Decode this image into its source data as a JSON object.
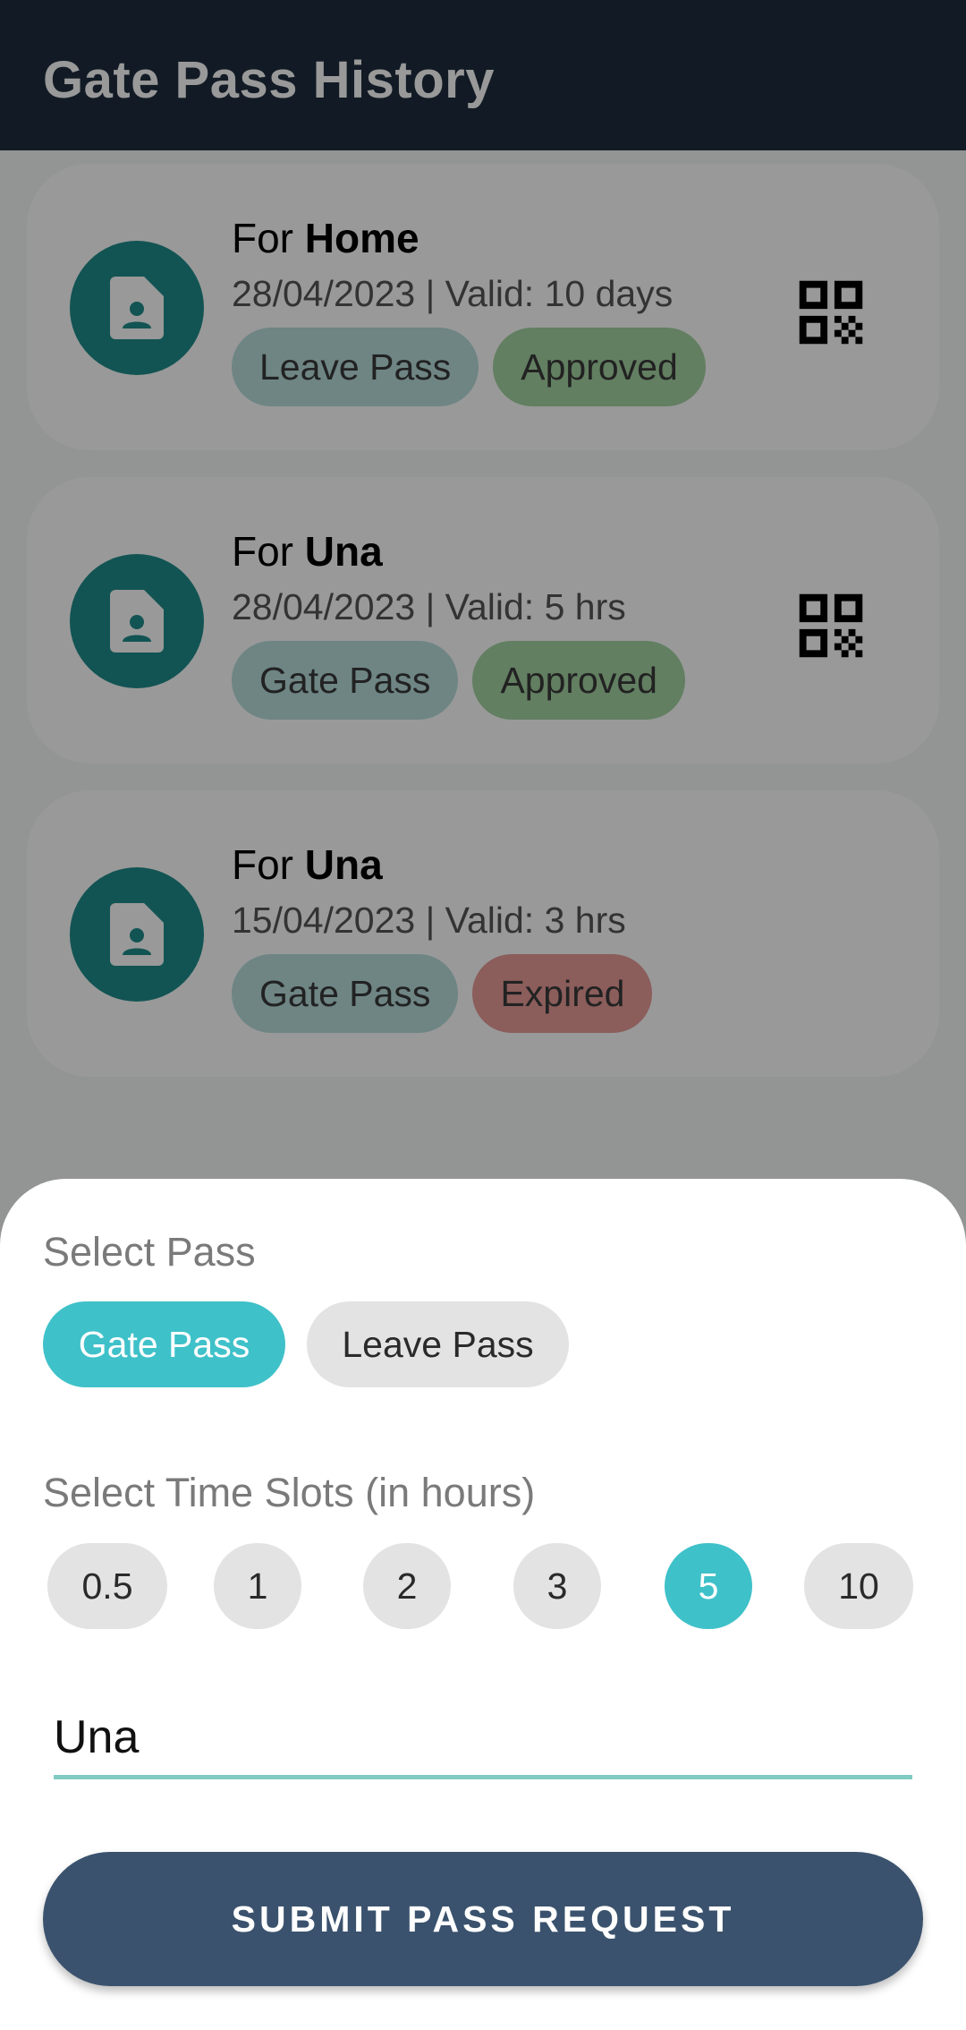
{
  "app_bar": {
    "title": "Gate Pass History"
  },
  "history": {
    "cards": [
      {
        "prefix": "For",
        "destination": "Home",
        "date": "28/04/2023",
        "separator": "|",
        "validity_label": "Valid:",
        "validity": "10 days",
        "type": "Leave Pass",
        "status": "Approved",
        "status_color": "#a4d4a2",
        "has_qr": true
      },
      {
        "prefix": "For",
        "destination": "Una",
        "date": "28/04/2023",
        "separator": "|",
        "validity_label": "Valid:",
        "validity": "5 hrs",
        "type": "Gate Pass",
        "status": "Approved",
        "status_color": "#a4d4a2",
        "has_qr": true
      },
      {
        "prefix": "For",
        "destination": "Una",
        "date": "15/04/2023",
        "separator": "|",
        "validity_label": "Valid:",
        "validity": "3 hrs",
        "type": "Gate Pass",
        "status": "Expired",
        "status_color": "#e89b98",
        "has_qr": false
      }
    ]
  },
  "sheet": {
    "pass_section_label": "Select Pass",
    "pass_types": [
      {
        "label": "Gate Pass",
        "selected": true
      },
      {
        "label": "Leave Pass",
        "selected": false
      }
    ],
    "time_section_label": "Select Time Slots (in hours)",
    "time_slots": [
      {
        "label": "0.5",
        "selected": false
      },
      {
        "label": "1",
        "selected": false
      },
      {
        "label": "2",
        "selected": false
      },
      {
        "label": "3",
        "selected": false
      },
      {
        "label": "5",
        "selected": true
      },
      {
        "label": "10",
        "selected": false
      }
    ],
    "destination_value": "Una",
    "submit_label": "SUBMIT PASS REQUEST"
  },
  "colors": {
    "app_bar": "#1e2d3e",
    "accent": "#3fc1c9",
    "icon_circle": "#1f8c8a",
    "submit_button": "#3a526d",
    "input_underline": "#80cbc4"
  },
  "icons": {
    "pass_avatar": "document-person-icon",
    "qr": "qr-code-icon"
  }
}
